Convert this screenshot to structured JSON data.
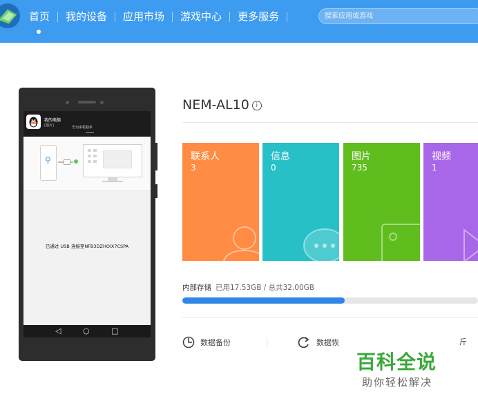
{
  "nav": {
    "items": [
      "首页",
      "我的设备",
      "应用市场",
      "游戏中心",
      "更多服务"
    ],
    "active_index": 0,
    "search_placeholder": "搜索应用或游戏"
  },
  "phone_preview": {
    "notification_title": "我的电脑",
    "notification_subtitle": "[图片]",
    "notification_middle": "华为手机助手",
    "connection_text": "已通过 USB 连接至NFB3DZHOIX7CSPA",
    "nav_buttons": [
      "◁",
      "○",
      "□"
    ]
  },
  "device": {
    "name": "NEM-AL10",
    "info_icon": "ⓘ"
  },
  "tiles": [
    {
      "label": "联系人",
      "count": "3",
      "color": "#ff8c42",
      "icon": "person-icon"
    },
    {
      "label": "信息",
      "count": "0",
      "color": "#26c0c6",
      "icon": "chat-icon"
    },
    {
      "label": "图片",
      "count": "735",
      "color": "#5fbd1e",
      "icon": "image-icon"
    },
    {
      "label": "视频",
      "count": "1",
      "color": "#a866e8",
      "icon": "video-icon"
    }
  ],
  "storage": {
    "label": "内部存储",
    "usage": "已用17.53GB / 总共32.00GB",
    "used_fraction": 0.548
  },
  "actions": {
    "backup": "数据备份",
    "restore": "数据恢",
    "extra": "斤"
  },
  "watermark": {
    "main": "百科全说",
    "sub": "助你轻松解决"
  }
}
